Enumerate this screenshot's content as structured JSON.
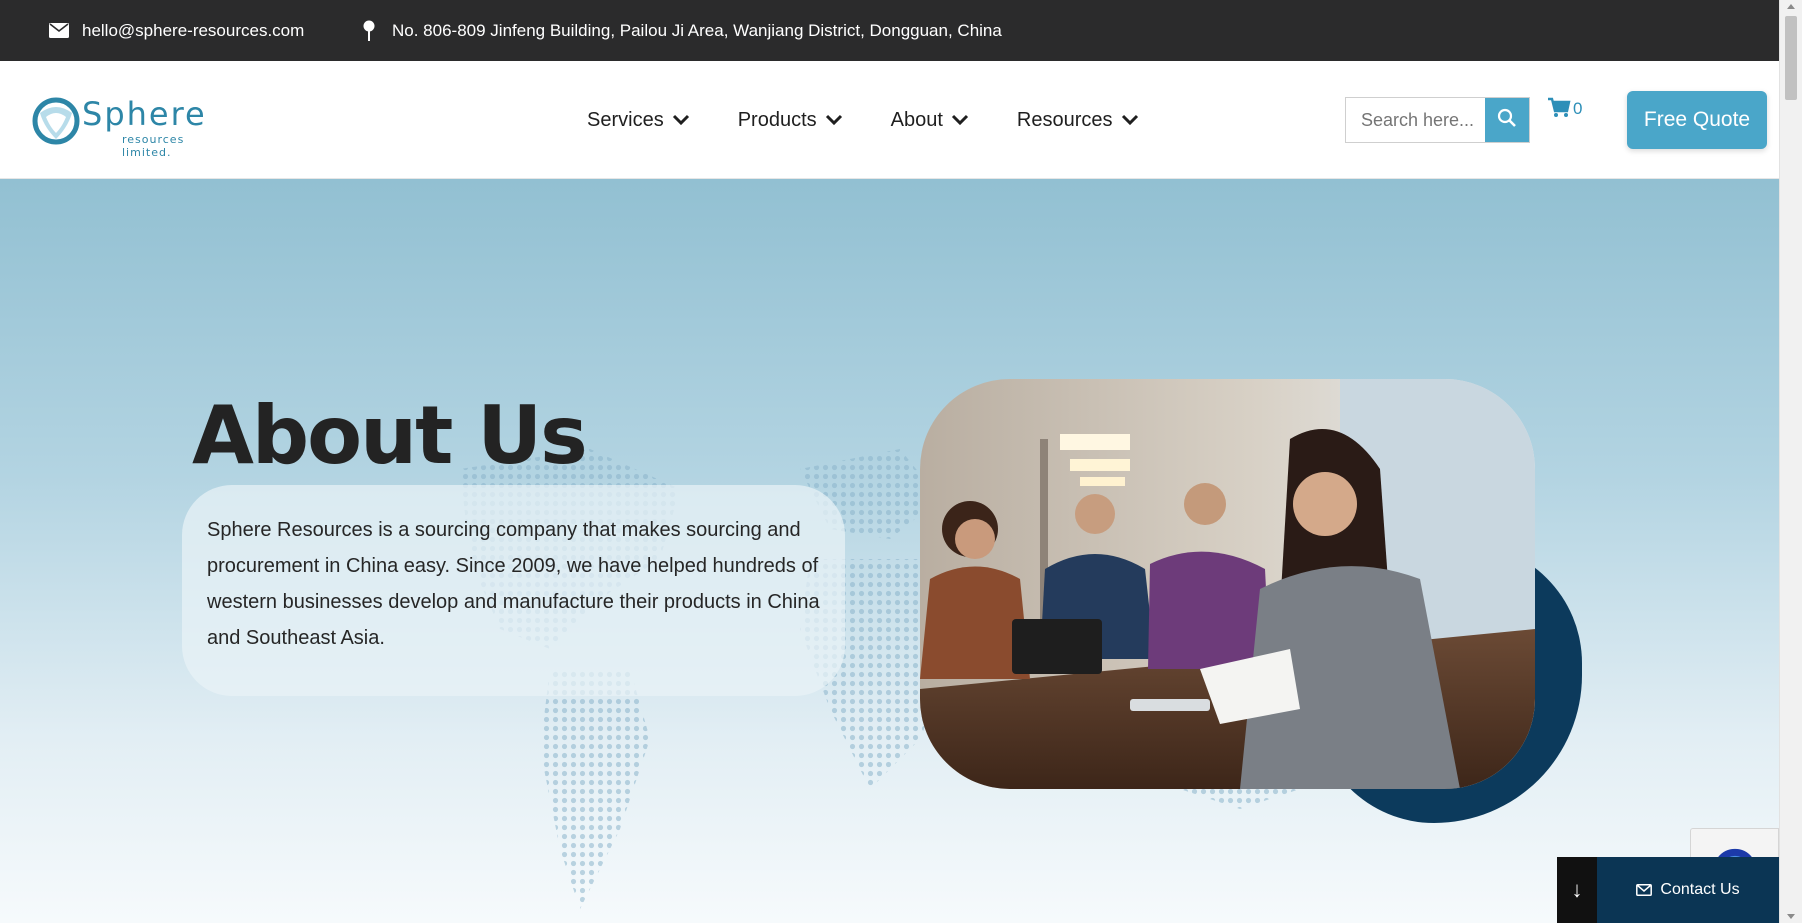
{
  "topbar": {
    "email": "hello@sphere-resources.com",
    "address": "No. 806-809 Jinfeng Building, Pailou Ji Area, Wanjiang District, Dongguan, China",
    "email_icon": "envelope-icon",
    "address_icon": "map-pin-icon"
  },
  "header": {
    "logo_text": "Sphere",
    "logo_subtext": "resources limited.",
    "nav": [
      {
        "label": "Services"
      },
      {
        "label": "Products"
      },
      {
        "label": "About"
      },
      {
        "label": "Resources"
      }
    ],
    "search_placeholder": "Search here...",
    "cart_count": "0",
    "quote_label": "Free Quote"
  },
  "hero": {
    "title": "About Us",
    "description": "Sphere Resources is a sourcing company that makes sourcing and procurement in China easy. Since 2009, we have helped hundreds of western businesses develop and manufacture their products in China and Southeast Asia."
  },
  "widgets": {
    "contact_label": "Contact Us",
    "contact_arrow": "↓"
  },
  "colors": {
    "topbar_bg": "#2b2b2c",
    "accent": "#4aa6c9",
    "navy": "#0b3554",
    "hero_top": "#92c0d2"
  }
}
